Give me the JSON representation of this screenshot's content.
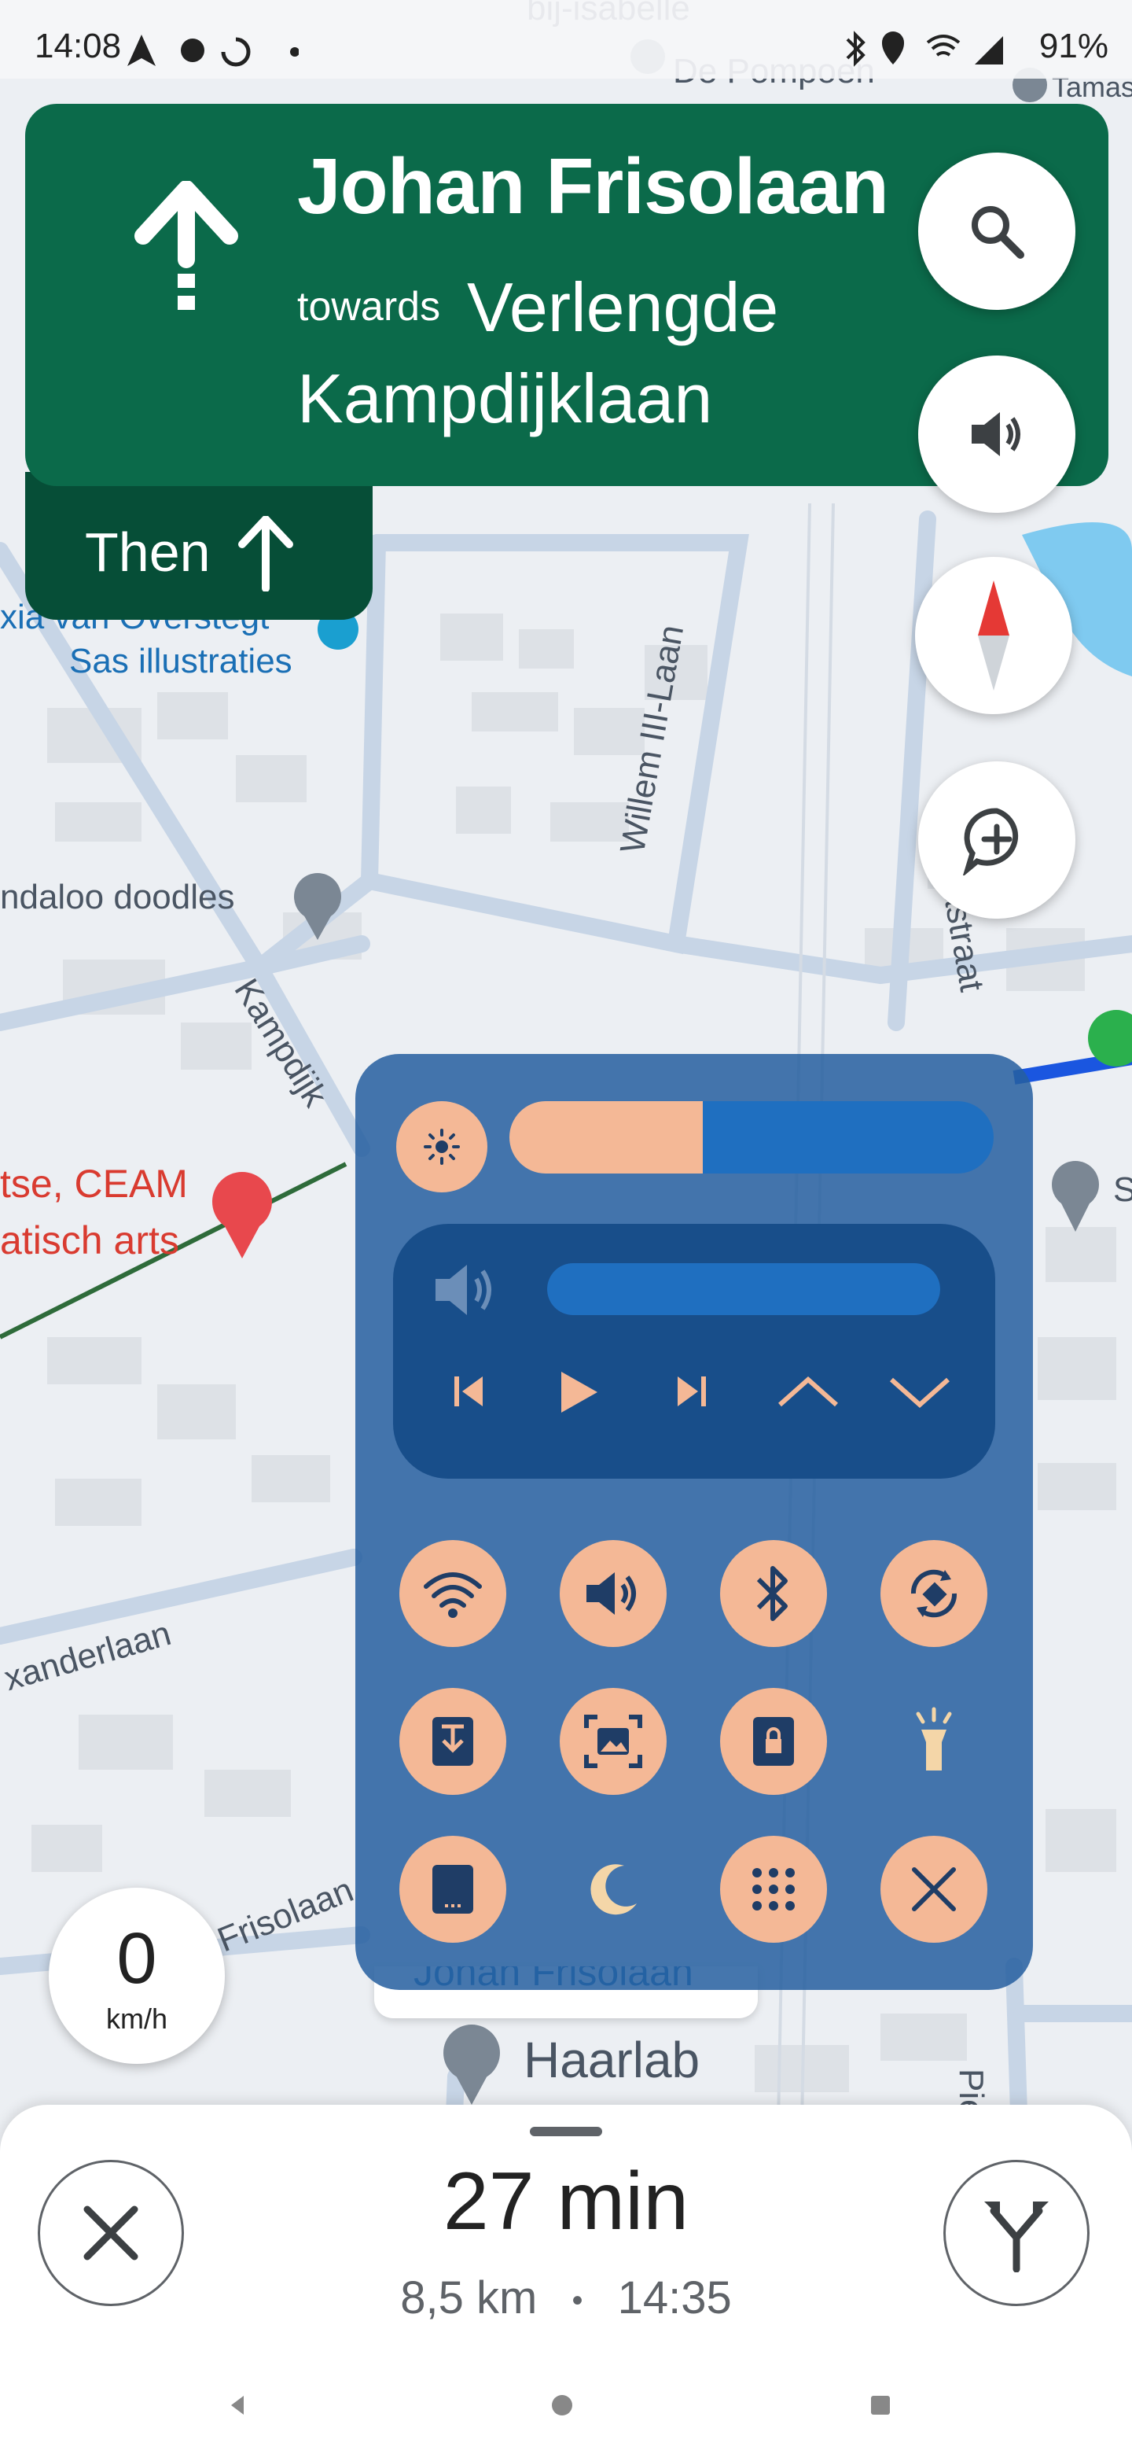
{
  "status_bar": {
    "time": "14:08",
    "battery": "91%",
    "icons": [
      "navigation-icon",
      "android-icon",
      "sync-icon",
      "dot-icon",
      "bluetooth-icon",
      "location-icon",
      "wifi-icon",
      "signal-icon"
    ]
  },
  "map": {
    "labels": {
      "bij_isabelle": "bij-isabelle",
      "de_pompoen": "De Pompoen",
      "tamas": "Tamas",
      "sas": "Sas illustraties",
      "xia": "xia van Overstegt",
      "andaloo": "ndaloo doodles",
      "willem": "Willem III-Laan",
      "kampdijk": "Kampdijk",
      "ellastraat": "ellastraat",
      "ceam1": "tse, CEAM",
      "ceam2": "atisch arts",
      "xanderlaan": "xanderlaan",
      "frisolaan": "Frisolaan",
      "haarlab": "Haarlab",
      "piete": "Piete",
      "s": "S"
    },
    "route_chip": "Johan Frisolaan"
  },
  "direction": {
    "street": "Johan Frisolaan",
    "towards": "towards",
    "dest_line1": "Verlengde",
    "dest_line2": "Kampdijklaan",
    "then": "Then"
  },
  "speed": {
    "value": "0",
    "unit": "km/h"
  },
  "panel": {
    "brightness_level": 0.4,
    "volume_level": 1.0,
    "colors": {
      "panel": "#2660a0",
      "accent": "#f4b896",
      "slider": "#1f6fc0"
    },
    "toggles": [
      "wifi-icon",
      "volume-icon",
      "bluetooth-icon",
      "auto-rotate-icon",
      "download-icon",
      "screenshot-icon",
      "lock-icon",
      "flashlight-icon",
      "phone-icon",
      "night-mode-icon",
      "apps-grid-icon",
      "close-icon"
    ]
  },
  "eta": {
    "time": "27 min",
    "distance": "8,5 km",
    "separator": "•",
    "arrival": "14:35"
  },
  "colors": {
    "direction_card": "#0b6a4a",
    "then_box": "#064e37"
  }
}
